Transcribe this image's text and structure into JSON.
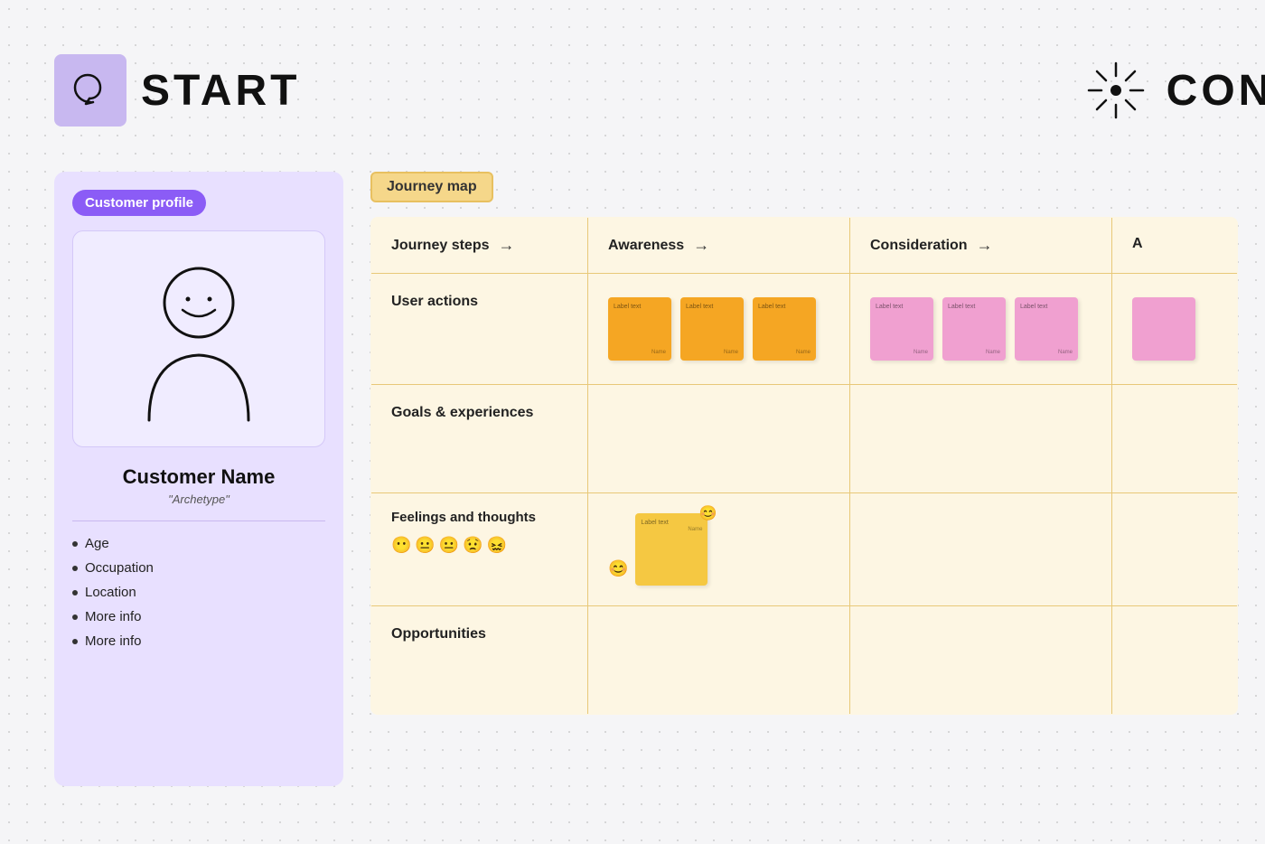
{
  "header": {
    "left_title": "START",
    "right_title": "CONTI"
  },
  "customer_profile": {
    "label": "Customer profile",
    "name": "Customer Name",
    "archetype": "\"Archetype\"",
    "list_items": [
      "Age",
      "Occupation",
      "Location",
      "More info",
      "More info"
    ]
  },
  "journey_map": {
    "label": "Journey map",
    "columns": [
      {
        "key": "steps",
        "label": "Journey steps",
        "has_arrow": true
      },
      {
        "key": "awareness",
        "label": "Awareness",
        "has_arrow": true
      },
      {
        "key": "consideration",
        "label": "Consideration",
        "has_arrow": true
      },
      {
        "key": "action",
        "label": "A",
        "has_arrow": false
      }
    ],
    "rows": [
      {
        "key": "user_actions",
        "label": "User actions",
        "awareness_notes": [
          {
            "color": "orange",
            "text": "Label text",
            "footer": "Name"
          },
          {
            "color": "orange",
            "text": "Label text",
            "footer": "Name"
          },
          {
            "color": "orange",
            "text": "Label text",
            "footer": "Name"
          }
        ],
        "consideration_notes": [
          {
            "color": "pink",
            "text": "Label text",
            "footer": "Name"
          },
          {
            "color": "pink",
            "text": "Label text",
            "footer": "Name"
          },
          {
            "color": "pink",
            "text": "Label text",
            "footer": "Name"
          }
        ],
        "action_notes": [
          {
            "color": "pink",
            "text": "",
            "footer": ""
          }
        ]
      },
      {
        "key": "goals_experiences",
        "label": "Goals & experiences"
      },
      {
        "key": "feelings_thoughts",
        "label": "Feelings and thoughts",
        "emojis": [
          "😶",
          "😐",
          "😐",
          "😟",
          "😖"
        ],
        "awareness_note": {
          "color": "yellow",
          "text": "Label text",
          "footer": "Name"
        },
        "awareness_emoji_left": "😊",
        "awareness_emoji_overlay": "😊"
      },
      {
        "key": "opportunities",
        "label": "Opportunities"
      }
    ]
  }
}
